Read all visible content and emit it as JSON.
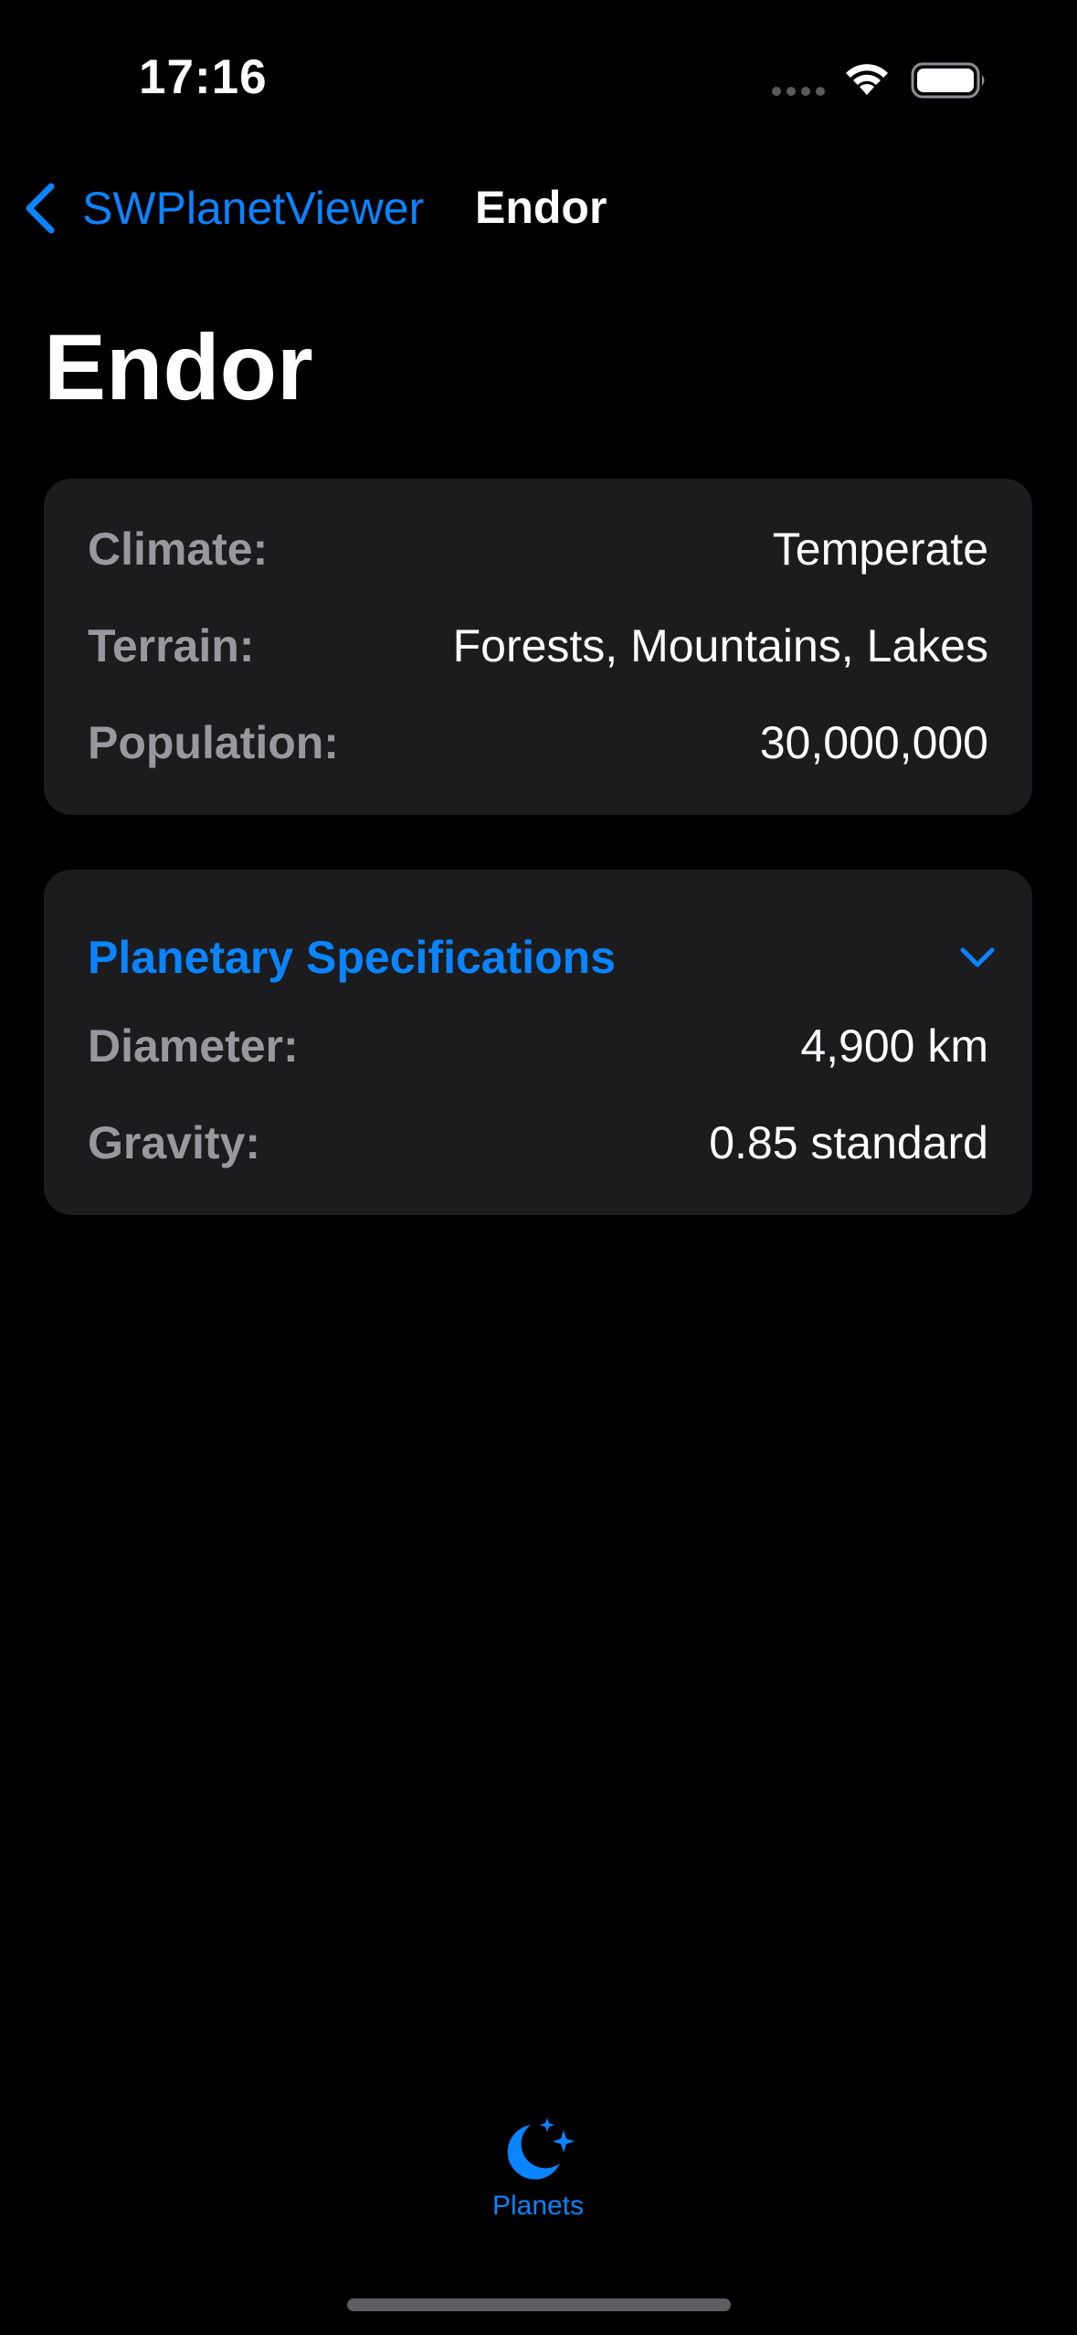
{
  "status_bar": {
    "time": "17:16"
  },
  "nav": {
    "back_label": "SWPlanetViewer",
    "title": "Endor"
  },
  "page": {
    "title": "Endor"
  },
  "info_card": {
    "rows": [
      {
        "label": "Climate:",
        "value": "Temperate"
      },
      {
        "label": "Terrain:",
        "value": "Forests, Mountains, Lakes"
      },
      {
        "label": "Population:",
        "value": "30,000,000"
      }
    ]
  },
  "specs_card": {
    "title": "Planetary Specifications",
    "expanded": true,
    "rows": [
      {
        "label": "Diameter:",
        "value": "4,900 km"
      },
      {
        "label": "Gravity:",
        "value": "0.85 standard"
      }
    ]
  },
  "tab_bar": {
    "items": [
      {
        "label": "Planets",
        "icon": "moon-stars-icon",
        "selected": true
      }
    ]
  },
  "colors": {
    "accent": "#0a84ff",
    "background": "#000000",
    "card": "#1c1c1e",
    "secondary_label": "#98989f"
  }
}
